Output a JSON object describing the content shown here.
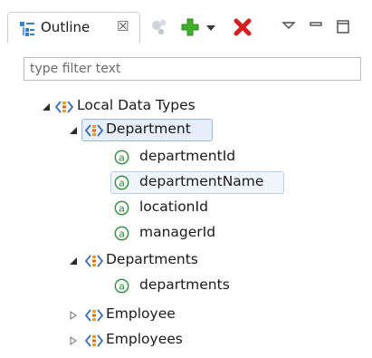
{
  "view": {
    "tab_title": "Outline",
    "tab_close_symbol": "☒"
  },
  "filter": {
    "placeholder": "type filter text"
  },
  "tree": {
    "root": {
      "label": "Local Data Types",
      "expanded": true
    },
    "department": {
      "label": "Department",
      "expanded": true,
      "selected": true
    },
    "department_children": [
      "departmentId",
      "departmentName",
      "locationId",
      "managerId"
    ],
    "departments": {
      "label": "Departments",
      "expanded": true
    },
    "departments_children": [
      "departments"
    ],
    "employee": {
      "label": "Employee",
      "expanded": false
    },
    "employees": {
      "label": "Employees",
      "expanded": false
    }
  },
  "icons": {
    "outline": "outline-view-icon",
    "collapsed": "collapsed-twisty",
    "expanded": "expanded-twisty",
    "type": "data-type-icon",
    "attribute": "attribute-icon"
  },
  "colors": {
    "selection_fill": "#e5eefa",
    "selection_border": "#99b9e3",
    "add": "#3fae2a",
    "delete": "#d62020",
    "attribute_green": "#2e8b3a"
  }
}
